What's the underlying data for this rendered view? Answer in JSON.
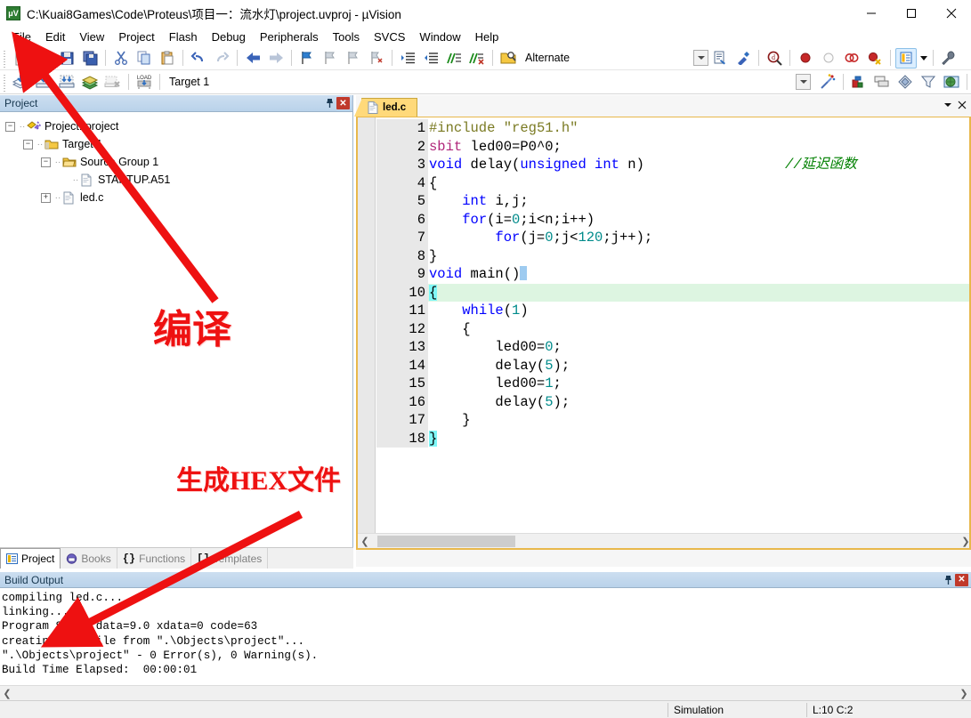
{
  "window": {
    "title": "C:\\Kuai8Games\\Code\\Proteus\\项目一：流水灯\\project.uvproj - µVision",
    "app_icon": "keil-uvision-icon",
    "minimize_label": "minimize-icon",
    "maximize_label": "maximize-icon",
    "close_label": "close-icon"
  },
  "menubar": {
    "items": [
      {
        "label": "File"
      },
      {
        "label": "Edit"
      },
      {
        "label": "View"
      },
      {
        "label": "Project"
      },
      {
        "label": "Flash"
      },
      {
        "label": "Debug"
      },
      {
        "label": "Peripherals"
      },
      {
        "label": "Tools"
      },
      {
        "label": "SVCS"
      },
      {
        "label": "Window"
      },
      {
        "label": "Help"
      }
    ]
  },
  "toolbar_main": {
    "buttons": [
      {
        "name": "new-file-icon",
        "glyph": "📄"
      },
      {
        "name": "open-file-icon",
        "glyph": "📂"
      },
      {
        "name": "save-icon",
        "glyph": "💾"
      },
      {
        "name": "save-all-icon",
        "glyph": "🗂"
      },
      {
        "sep": true
      },
      {
        "name": "cut-icon",
        "glyph": "✂"
      },
      {
        "name": "copy-icon",
        "glyph": "⧉"
      },
      {
        "name": "paste-icon",
        "glyph": "📋"
      },
      {
        "sep": true
      },
      {
        "name": "undo-icon",
        "glyph": "↶"
      },
      {
        "name": "redo-icon",
        "glyph": "↷"
      },
      {
        "sep": true
      },
      {
        "name": "navigate-backward-icon",
        "glyph": "←"
      },
      {
        "name": "navigate-forward-icon",
        "glyph": "→"
      },
      {
        "sep": true
      },
      {
        "name": "insert-bookmark-icon",
        "glyph": "⚑"
      },
      {
        "name": "previous-bookmark-icon",
        "glyph": "⚐"
      },
      {
        "name": "next-bookmark-icon",
        "glyph": "⚐"
      },
      {
        "name": "clear-bookmarks-icon",
        "glyph": "⚐"
      },
      {
        "sep": true
      },
      {
        "name": "indent-icon",
        "glyph": "⇥"
      },
      {
        "name": "outdent-icon",
        "glyph": "⇤"
      },
      {
        "name": "comment-lines-icon",
        "glyph": "//"
      },
      {
        "name": "uncomment-lines-icon",
        "glyph": "//"
      },
      {
        "sep": true
      },
      {
        "name": "find-in-files-icon",
        "glyph": "🔍"
      }
    ],
    "alternate_label": "Alternate",
    "right_buttons": [
      {
        "name": "configuration-wizard-icon",
        "glyph": "📑"
      },
      {
        "name": "debug-settings-icon",
        "glyph": "⚒"
      },
      {
        "sep": true
      },
      {
        "name": "start-debug-session-icon",
        "glyph": "🔎"
      },
      {
        "sep": true
      },
      {
        "name": "insert-breakpoint-icon",
        "glyph": "●"
      },
      {
        "name": "disable-breakpoint-icon",
        "glyph": "○"
      },
      {
        "name": "disable-all-breakpoints-icon",
        "glyph": "◌"
      },
      {
        "name": "kill-all-breakpoints-icon",
        "glyph": "◉"
      },
      {
        "sep": true
      },
      {
        "name": "manage-windows-icon",
        "glyph": "▤"
      },
      {
        "sep": true
      },
      {
        "name": "configure-target-icon",
        "glyph": "🔧"
      }
    ]
  },
  "toolbar_build": {
    "buttons": [
      {
        "name": "translate-file-icon",
        "glyph": "◈"
      },
      {
        "name": "build-target-icon",
        "glyph": "▣"
      },
      {
        "name": "rebuild-all-icon",
        "glyph": "▣"
      },
      {
        "name": "batch-build-icon",
        "glyph": "▤"
      },
      {
        "name": "stop-build-icon",
        "glyph": "▧"
      },
      {
        "sep": true
      },
      {
        "name": "download-to-flash-icon",
        "glyph": "LOAD"
      },
      {
        "sep": true
      }
    ],
    "target_selector_value": "Target 1",
    "right_buttons": [
      {
        "name": "target-options-icon",
        "glyph": "⚙"
      },
      {
        "sep": true
      },
      {
        "name": "manage-project-items-icon",
        "glyph": "▦"
      },
      {
        "name": "multi-project-icon",
        "glyph": "▥"
      },
      {
        "name": "components-icon",
        "glyph": "◆"
      },
      {
        "name": "filter-icon",
        "glyph": "▽"
      },
      {
        "name": "pack-installer-icon",
        "glyph": "◉"
      }
    ]
  },
  "project_panel": {
    "title": "Project",
    "pin_icon": "pin-icon",
    "close_icon": "close-icon",
    "tree": [
      {
        "label": "Project: project",
        "depth": 0,
        "expander": "-",
        "icon": "project-icon"
      },
      {
        "label": "Target 1",
        "depth": 1,
        "expander": "-",
        "icon": "target-folder-icon"
      },
      {
        "label": "Source Group 1",
        "depth": 2,
        "expander": "-",
        "icon": "source-group-folder-icon"
      },
      {
        "label": "STARTUP.A51",
        "depth": 3,
        "expander": "",
        "icon": "asm-file-icon"
      },
      {
        "label": "led.c",
        "depth": 3,
        "expander": "+",
        "icon": "c-file-icon"
      }
    ],
    "tabs": [
      {
        "label": "Project",
        "icon": "project-tab-icon",
        "selected": true
      },
      {
        "label": "Books",
        "icon": "books-tab-icon",
        "selected": false
      },
      {
        "label": "Functions",
        "icon": "functions-tab-icon",
        "selected": false
      },
      {
        "label": "Templates",
        "icon": "templates-tab-icon",
        "selected": false
      }
    ]
  },
  "editor": {
    "tabs": [
      {
        "label": "led.c",
        "icon": "c-file-icon",
        "active": true
      }
    ],
    "dropdown_icon": "chevron-down-icon",
    "close_icon": "close-icon",
    "lines": [
      {
        "no": "1",
        "html": "<span class='k-pre'>#include</span> <span class='k-str'>\"reg51.h\"</span>"
      },
      {
        "no": "2",
        "html": "<span class='k-sbit'>sbit</span> <span class='k-plain'>led00=P0^0;</span>"
      },
      {
        "no": "3",
        "html": "<span class='k-kw'>void</span> <span class='k-plain'>delay(</span><span class='k-kw'>unsigned int</span> <span class='k-plain'>n)</span>                 <span class='k-cmt'>//延迟函数</span>"
      },
      {
        "no": "4",
        "html": "<span class='k-plain'>{</span>"
      },
      {
        "no": "5",
        "html": "    <span class='k-kw'>int</span> <span class='k-plain'>i,j;</span>"
      },
      {
        "no": "6",
        "html": "    <span class='k-kw'>for</span><span class='k-plain'>(i=</span><span class='k-num'>0</span><span class='k-plain'>;i&lt;n;i++)</span>"
      },
      {
        "no": "7",
        "html": "        <span class='k-kw'>for</span><span class='k-plain'>(j=</span><span class='k-num'>0</span><span class='k-plain'>;j&lt;</span><span class='k-num'>120</span><span class='k-plain'>;j++);</span>"
      },
      {
        "no": "8",
        "html": "<span class='k-plain'>}</span>"
      },
      {
        "no": "9",
        "html": "<span class='k-kw'>void</span> <span class='k-plain'>main()</span><span class='caret-blk'></span>"
      },
      {
        "no": "10",
        "html": "<span class='k-plain brace-hl'>{</span>",
        "highlight": true
      },
      {
        "no": "11",
        "html": "    <span class='k-kw'>while</span><span class='k-plain'>(</span><span class='k-num'>1</span><span class='k-plain'>)</span>"
      },
      {
        "no": "12",
        "html": "    <span class='k-plain'>{</span>"
      },
      {
        "no": "13",
        "html": "        <span class='k-plain'>led00=</span><span class='k-num'>0</span><span class='k-plain'>;</span>"
      },
      {
        "no": "14",
        "html": "        <span class='k-plain'>delay(</span><span class='k-num'>5</span><span class='k-plain'>);</span>"
      },
      {
        "no": "15",
        "html": "        <span class='k-plain'>led00=</span><span class='k-num'>1</span><span class='k-plain'>;</span>"
      },
      {
        "no": "16",
        "html": "        <span class='k-plain'>delay(</span><span class='k-num'>5</span><span class='k-plain'>);</span>"
      },
      {
        "no": "17",
        "html": "    <span class='k-plain'>}</span>"
      },
      {
        "no": "18",
        "html": "<span class='k-plain brace-hl'>}</span>"
      }
    ],
    "scroll_left_icon": "chevron-left-icon",
    "scroll_right_icon": "chevron-right-icon"
  },
  "build_output": {
    "title": "Build Output",
    "pin_icon": "pin-icon",
    "close_icon": "close-icon",
    "text": "compiling led.c...\nlinking...\nProgram Size: data=9.0 xdata=0 code=63\ncreating hex file from \".\\Objects\\project\"...\n\".\\Objects\\project\" - 0 Error(s), 0 Warning(s).\nBuild Time Elapsed:  00:00:01",
    "scroll_left_icon": "chevron-left-icon",
    "scroll_right_icon": "chevron-right-icon"
  },
  "statusbar": {
    "left": "",
    "simulation": "Simulation",
    "cursor_position": "L:10 C:2"
  },
  "annotations": [
    {
      "id": "compile",
      "text": "编译",
      "color": "#ee1111"
    },
    {
      "id": "hex",
      "text": "生成HEX文件",
      "color": "#ee1111"
    }
  ],
  "colors": {
    "accent_tab": "#ffd97a",
    "panel_header": "#c0d8ef",
    "annotation_red": "#ee1111",
    "keyword_blue": "#0000ff",
    "comment_green": "#008000",
    "string_olive": "#7a7a22",
    "number_teal": "#008b8b",
    "sbit_magenta": "#b0267a",
    "current_line": "#ddf5e1",
    "brace_match": "#7ff7f7"
  }
}
